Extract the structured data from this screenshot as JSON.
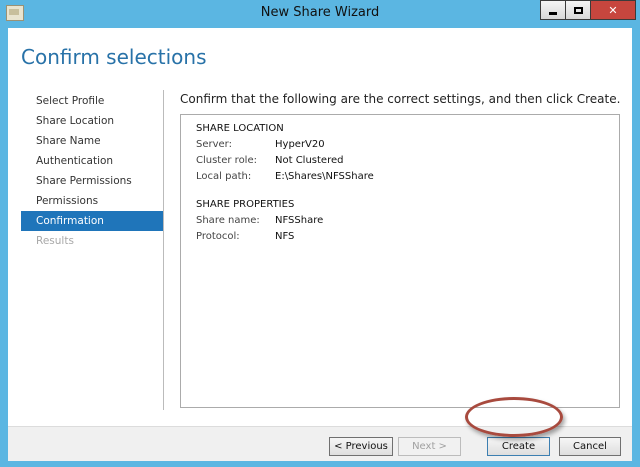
{
  "window": {
    "title": "New Share Wizard",
    "close_glyph": "✕"
  },
  "heading": "Confirm selections",
  "nav": {
    "items": [
      {
        "label": "Select Profile"
      },
      {
        "label": "Share Location"
      },
      {
        "label": "Share Name"
      },
      {
        "label": "Authentication"
      },
      {
        "label": "Share Permissions"
      },
      {
        "label": "Permissions"
      },
      {
        "label": "Confirmation"
      },
      {
        "label": "Results"
      }
    ],
    "active": "Confirmation"
  },
  "instruction": "Confirm that the following are the correct settings, and then click Create.",
  "summary": {
    "share_location": {
      "title": "SHARE LOCATION",
      "rows": [
        {
          "key": "Server:",
          "value": "HyperV20"
        },
        {
          "key": "Cluster role:",
          "value": "Not Clustered"
        },
        {
          "key": "Local path:",
          "value": "E:\\Shares\\NFSShare"
        }
      ]
    },
    "share_properties": {
      "title": "SHARE PROPERTIES",
      "rows": [
        {
          "key": "Share name:",
          "value": "NFSShare"
        },
        {
          "key": "Protocol:",
          "value": "NFS"
        }
      ]
    }
  },
  "buttons": {
    "previous": "< Previous",
    "next": "Next >",
    "create": "Create",
    "cancel": "Cancel"
  },
  "colors": {
    "title_bar": "#5bb6e2",
    "heading": "#2872a8",
    "nav_active": "#1f75ba",
    "close_button": "#c7463e",
    "highlight_ring": "#a84a3e"
  }
}
